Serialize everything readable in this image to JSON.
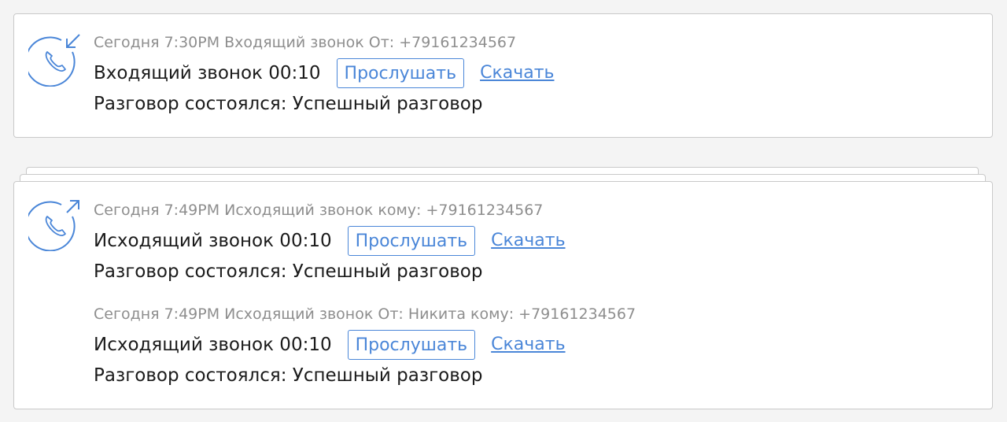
{
  "calls": [
    {
      "direction_icon": "incoming-call-icon",
      "meta": "Сегодня 7:30PM Входящий звонок От: +79161234567",
      "title": "Входящий звонок 00:10",
      "listen_label": "Прослушать",
      "download_label": "Скачать",
      "result": "Разговор состоялся: Успешный разговор"
    },
    {
      "direction_icon": "outgoing-call-icon",
      "meta": "Сегодня 7:49PM Исходящий звонок кому: +79161234567",
      "title": "Исходящий звонок 00:10",
      "listen_label": "Прослушать",
      "download_label": "Скачать",
      "result": "Разговор состоялся: Успешный разговор"
    },
    {
      "meta": "Сегодня 7:49PM Исходящий звонок От: Никита кому: +79161234567",
      "title": "Исходящий звонок 00:10",
      "listen_label": "Прослушать",
      "download_label": "Скачать",
      "result": "Разговор состоялся: Успешный разговор"
    }
  ],
  "colors": {
    "accent": "#4a86d8",
    "meta_text": "#8e8e8e",
    "main_text": "#1b1b1b",
    "card_border": "#c9c9c9",
    "background": "#f4f4f4"
  }
}
